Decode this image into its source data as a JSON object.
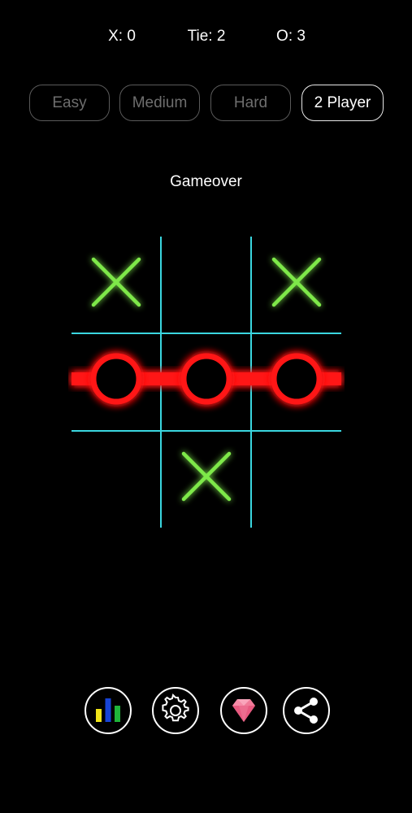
{
  "scoreboard": {
    "x_label": "X: 0",
    "tie_label": "Tie: 2",
    "o_label": "O: 3"
  },
  "modes": [
    {
      "label": "Easy",
      "selected": false
    },
    {
      "label": "Medium",
      "selected": false
    },
    {
      "label": "Hard",
      "selected": false
    },
    {
      "label": "2 Player",
      "selected": true
    }
  ],
  "status": "Gameover",
  "board": {
    "cells": [
      "X",
      "",
      "X",
      "O",
      "O",
      "O",
      "",
      "X",
      ""
    ],
    "winning_line": "middle-row",
    "colors": {
      "grid": "#3ad6e0",
      "x": "#7ee84a",
      "o": "#ff1414",
      "win_line": "#ff1414"
    }
  },
  "toolbar": {
    "items": [
      {
        "name": "stats-icon"
      },
      {
        "name": "settings-gear-icon"
      },
      {
        "name": "gem-icon"
      },
      {
        "name": "share-icon"
      }
    ]
  }
}
